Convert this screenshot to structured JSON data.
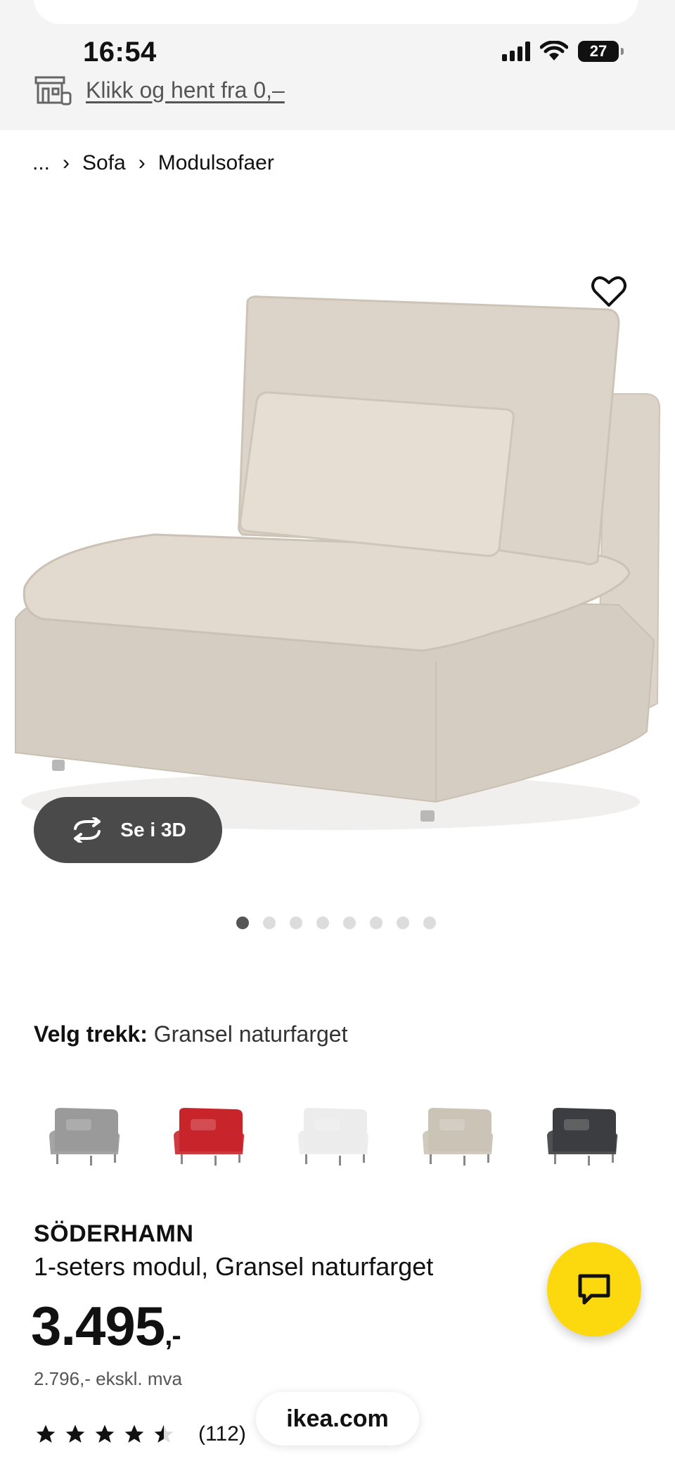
{
  "status_bar": {
    "time": "16:54",
    "battery": "27",
    "signal_icon": "cellular-signal-icon",
    "wifi_icon": "wifi-icon"
  },
  "store_banner": {
    "icon": "store-icon",
    "link_text": "Klikk og hent fra 0,–"
  },
  "breadcrumb": {
    "ellipsis": "...",
    "items": [
      "Sofa",
      "Modulsofaer"
    ]
  },
  "gallery": {
    "see_3d_label": "Se i 3D",
    "slide_count": 8,
    "active_slide": 1,
    "favorite_icon": "heart-icon"
  },
  "cover": {
    "label": "Velg trekk:",
    "selected": "Gransel naturfarget"
  },
  "swatches": [
    {
      "name": "grey",
      "color": "#9a9a9a"
    },
    {
      "name": "red",
      "color": "#c8252b"
    },
    {
      "name": "white",
      "color": "#ececec"
    },
    {
      "name": "beige",
      "color": "#cbc3b6"
    },
    {
      "name": "dark-grey",
      "color": "#3c3d40"
    }
  ],
  "product": {
    "name": "SÖDERHAMN",
    "description": "1-seters modul, Gransel naturfarget",
    "price": "3.495",
    "price_suffix": ",-",
    "price_ex_vat": "2.796,- ekskl. mva",
    "rating": 4.5,
    "review_count": "(112)"
  },
  "chat_icon": "chat-bubble-icon",
  "browser": {
    "domain": "ikea.com"
  },
  "colors": {
    "accent_yellow": "#fcd80f",
    "button_dark": "#4a4a4a"
  }
}
